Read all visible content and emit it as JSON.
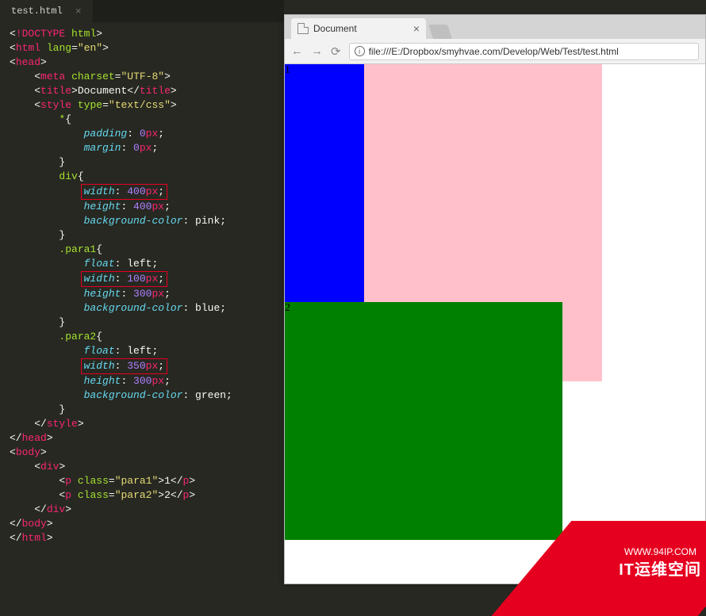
{
  "editor": {
    "tab_name": "test.html",
    "code_lines": [
      [
        [
          "ang",
          "<"
        ],
        [
          "tag",
          "!DOCTYPE"
        ],
        [
          "txt",
          " "
        ],
        [
          "attr",
          "html"
        ],
        [
          "ang",
          ">"
        ]
      ],
      [
        [
          "ang",
          "<"
        ],
        [
          "tag",
          "html"
        ],
        [
          "txt",
          " "
        ],
        [
          "attr",
          "lang"
        ],
        [
          "txt",
          "="
        ],
        [
          "str",
          "\"en\""
        ],
        [
          "ang",
          ">"
        ]
      ],
      [
        [
          "ang",
          "<"
        ],
        [
          "tag",
          "head"
        ],
        [
          "ang",
          ">"
        ]
      ],
      [
        [
          "txt",
          "    "
        ],
        [
          "ang",
          "<"
        ],
        [
          "tag",
          "meta"
        ],
        [
          "txt",
          " "
        ],
        [
          "attr",
          "charset"
        ],
        [
          "txt",
          "="
        ],
        [
          "str",
          "\"UTF-8\""
        ],
        [
          "ang",
          ">"
        ]
      ],
      [
        [
          "txt",
          "    "
        ],
        [
          "ang",
          "<"
        ],
        [
          "tag",
          "title"
        ],
        [
          "ang",
          ">"
        ],
        [
          "txt",
          "Document"
        ],
        [
          "ang",
          "</"
        ],
        [
          "tag",
          "title"
        ],
        [
          "ang",
          ">"
        ]
      ],
      [
        [
          "txt",
          "    "
        ],
        [
          "ang",
          "<"
        ],
        [
          "tag",
          "style"
        ],
        [
          "txt",
          " "
        ],
        [
          "attr",
          "type"
        ],
        [
          "txt",
          "="
        ],
        [
          "str",
          "\"text/css\""
        ],
        [
          "ang",
          ">"
        ]
      ],
      [
        [
          "txt",
          "        "
        ],
        [
          "sel",
          "*"
        ],
        [
          "txt",
          "{"
        ]
      ],
      [
        [
          "txt",
          "            "
        ],
        [
          "prop",
          "padding"
        ],
        [
          "txt",
          ": "
        ],
        [
          "num",
          "0"
        ],
        [
          "unit",
          "px"
        ],
        [
          "txt",
          ";"
        ]
      ],
      [
        [
          "txt",
          "            "
        ],
        [
          "prop",
          "margin"
        ],
        [
          "txt",
          ": "
        ],
        [
          "num",
          "0"
        ],
        [
          "unit",
          "px"
        ],
        [
          "txt",
          ";"
        ]
      ],
      [
        [
          "txt",
          "        }"
        ]
      ],
      [
        [
          "txt",
          "        "
        ],
        [
          "sel",
          "div"
        ],
        [
          "txt",
          "{"
        ]
      ],
      [
        [
          "txt",
          "            "
        ],
        [
          "hlbox",
          [
            [
              "prop",
              "width"
            ],
            [
              "txt",
              ": "
            ],
            [
              "num",
              "400"
            ],
            [
              "unit",
              "px"
            ],
            [
              "txt",
              ";"
            ]
          ]
        ]
      ],
      [
        [
          "txt",
          "            "
        ],
        [
          "prop",
          "height"
        ],
        [
          "txt",
          ": "
        ],
        [
          "num",
          "400"
        ],
        [
          "unit",
          "px"
        ],
        [
          "txt",
          ";"
        ]
      ],
      [
        [
          "txt",
          "            "
        ],
        [
          "prop",
          "background-color"
        ],
        [
          "txt",
          ": pink;"
        ]
      ],
      [
        [
          "txt",
          "        }"
        ]
      ],
      [
        [
          "txt",
          "        "
        ],
        [
          "sel",
          ".para1"
        ],
        [
          "txt",
          "{"
        ]
      ],
      [
        [
          "txt",
          "            "
        ],
        [
          "prop",
          "float"
        ],
        [
          "txt",
          ": left;"
        ]
      ],
      [
        [
          "txt",
          "            "
        ],
        [
          "hlbox",
          [
            [
              "prop",
              "width"
            ],
            [
              "txt",
              ": "
            ],
            [
              "num",
              "100"
            ],
            [
              "unit",
              "px"
            ],
            [
              "txt",
              ";"
            ]
          ]
        ]
      ],
      [
        [
          "txt",
          "            "
        ],
        [
          "prop",
          "height"
        ],
        [
          "txt",
          ": "
        ],
        [
          "num",
          "300"
        ],
        [
          "unit",
          "px"
        ],
        [
          "txt",
          ";"
        ]
      ],
      [
        [
          "txt",
          "            "
        ],
        [
          "prop",
          "background-color"
        ],
        [
          "txt",
          ": blue;"
        ]
      ],
      [
        [
          "txt",
          "        }"
        ]
      ],
      [
        [
          "txt",
          "        "
        ],
        [
          "sel",
          ".para2"
        ],
        [
          "txt",
          "{"
        ]
      ],
      [
        [
          "txt",
          "            "
        ],
        [
          "prop",
          "float"
        ],
        [
          "txt",
          ": left;"
        ]
      ],
      [
        [
          "txt",
          "            "
        ],
        [
          "hlbox",
          [
            [
              "prop",
              "width"
            ],
            [
              "txt",
              ": "
            ],
            [
              "num",
              "350"
            ],
            [
              "unit",
              "px"
            ],
            [
              "txt",
              ";"
            ]
          ]
        ]
      ],
      [
        [
          "txt",
          "            "
        ],
        [
          "prop",
          "height"
        ],
        [
          "txt",
          ": "
        ],
        [
          "num",
          "300"
        ],
        [
          "unit",
          "px"
        ],
        [
          "txt",
          ";"
        ]
      ],
      [
        [
          "txt",
          "            "
        ],
        [
          "prop",
          "background-color"
        ],
        [
          "txt",
          ": green;"
        ]
      ],
      [
        [
          "txt",
          "        }"
        ]
      ],
      [
        [
          "txt",
          "    "
        ],
        [
          "ang",
          "</"
        ],
        [
          "tag",
          "style"
        ],
        [
          "ang",
          ">"
        ]
      ],
      [
        [
          "ang",
          "</"
        ],
        [
          "tag",
          "head"
        ],
        [
          "ang",
          ">"
        ]
      ],
      [
        [
          "ang",
          "<"
        ],
        [
          "tag",
          "body"
        ],
        [
          "ang",
          ">"
        ]
      ],
      [
        [
          "txt",
          "    "
        ],
        [
          "ang",
          "<"
        ],
        [
          "tag",
          "div"
        ],
        [
          "ang",
          ">"
        ]
      ],
      [
        [
          "txt",
          "        "
        ],
        [
          "ang",
          "<"
        ],
        [
          "tag",
          "p"
        ],
        [
          "txt",
          " "
        ],
        [
          "attr",
          "class"
        ],
        [
          "txt",
          "="
        ],
        [
          "str",
          "\"para1\""
        ],
        [
          "ang",
          ">"
        ],
        [
          "txt",
          "1"
        ],
        [
          "ang",
          "</"
        ],
        [
          "tag",
          "p"
        ],
        [
          "ang",
          ">"
        ]
      ],
      [
        [
          "txt",
          "        "
        ],
        [
          "ang",
          "<"
        ],
        [
          "tag",
          "p"
        ],
        [
          "txt",
          " "
        ],
        [
          "attr",
          "class"
        ],
        [
          "txt",
          "="
        ],
        [
          "str",
          "\"para2\""
        ],
        [
          "ang",
          ">"
        ],
        [
          "txt",
          "2"
        ],
        [
          "ang",
          "</"
        ],
        [
          "tag",
          "p"
        ],
        [
          "ang",
          ">"
        ]
      ],
      [
        [
          "txt",
          "    "
        ],
        [
          "ang",
          "</"
        ],
        [
          "tag",
          "div"
        ],
        [
          "ang",
          ">"
        ]
      ],
      [
        [
          "ang",
          "</"
        ],
        [
          "tag",
          "body"
        ],
        [
          "ang",
          ">"
        ]
      ],
      [
        [
          "ang",
          "</"
        ],
        [
          "tag",
          "html"
        ],
        [
          "ang",
          ">"
        ]
      ]
    ]
  },
  "browser": {
    "tab_title": "Document",
    "url": "file:///E:/Dropbox/smyhvae.com/Develop/Web/Test/test.html",
    "rendered": {
      "p1_text": "1",
      "p2_text": "2"
    }
  },
  "watermark": {
    "line1": "WWW.94IP.COM",
    "line2": "IT运维空间"
  }
}
